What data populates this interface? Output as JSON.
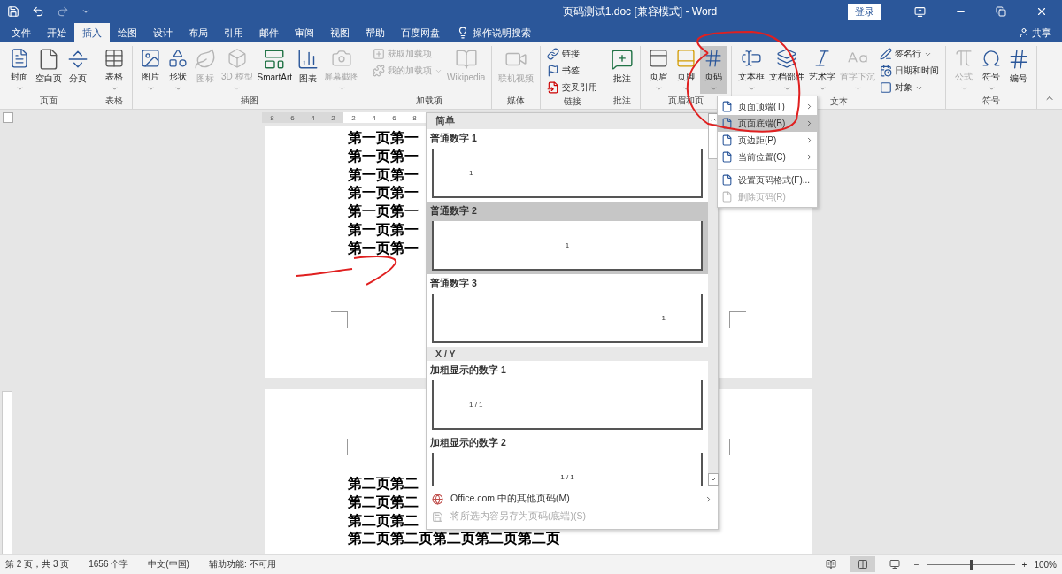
{
  "window": {
    "title": "页码测试1.doc [兼容模式] - Word",
    "login": "登录"
  },
  "tabs": [
    {
      "label": "文件",
      "selected": false
    },
    {
      "label": "开始",
      "selected": false
    },
    {
      "label": "插入",
      "selected": true
    },
    {
      "label": "绘图",
      "selected": false
    },
    {
      "label": "设计",
      "selected": false
    },
    {
      "label": "布局",
      "selected": false
    },
    {
      "label": "引用",
      "selected": false
    },
    {
      "label": "邮件",
      "selected": false
    },
    {
      "label": "审阅",
      "selected": false
    },
    {
      "label": "视图",
      "selected": false
    },
    {
      "label": "帮助",
      "selected": false
    },
    {
      "label": "百度网盘",
      "selected": false
    }
  ],
  "tell_me": "操作说明搜索",
  "share": "共享",
  "ribbon": {
    "groups": [
      {
        "label": "页面",
        "buttons": [
          {
            "label": "封面",
            "kind": "large",
            "dropdown": true,
            "disabled": false,
            "selected": false
          },
          {
            "label": "空白页",
            "kind": "large",
            "dropdown": false,
            "disabled": false,
            "selected": false
          },
          {
            "label": "分页",
            "kind": "large",
            "dropdown": false,
            "disabled": false,
            "selected": false
          }
        ]
      },
      {
        "label": "表格",
        "buttons": [
          {
            "label": "表格",
            "kind": "large",
            "dropdown": true,
            "disabled": false,
            "selected": false
          }
        ]
      },
      {
        "label": "插图",
        "buttons": [
          {
            "label": "图片",
            "kind": "large",
            "dropdown": true,
            "disabled": false,
            "selected": false
          },
          {
            "label": "形状",
            "kind": "large",
            "dropdown": true,
            "disabled": false,
            "selected": false
          },
          {
            "label": "图标",
            "kind": "large",
            "dropdown": false,
            "disabled": true,
            "selected": false
          },
          {
            "label": "3D 模型",
            "kind": "large",
            "dropdown": true,
            "disabled": true,
            "selected": false
          },
          {
            "label": "SmartArt",
            "kind": "large",
            "dropdown": false,
            "disabled": false,
            "selected": false
          },
          {
            "label": "图表",
            "kind": "large",
            "dropdown": false,
            "disabled": false,
            "selected": false
          },
          {
            "label": "屏幕截图",
            "kind": "large",
            "dropdown": true,
            "disabled": true,
            "selected": false
          }
        ]
      },
      {
        "label": "加载项",
        "buttons": [
          {
            "label": "获取加载项",
            "kind": "small",
            "dropdown": false,
            "disabled": true,
            "selected": false
          },
          {
            "label": "我的加载项",
            "kind": "small",
            "dropdown": true,
            "disabled": true,
            "selected": false
          },
          {
            "label": "Wikipedia",
            "kind": "large",
            "dropdown": false,
            "disabled": true,
            "selected": false
          }
        ]
      },
      {
        "label": "媒体",
        "buttons": [
          {
            "label": "联机视频",
            "kind": "large",
            "dropdown": false,
            "disabled": true,
            "selected": false
          }
        ]
      },
      {
        "label": "链接",
        "buttons": [
          {
            "label": "链接",
            "kind": "small",
            "dropdown": false,
            "disabled": false,
            "selected": false
          },
          {
            "label": "书签",
            "kind": "small",
            "dropdown": false,
            "disabled": false,
            "selected": false
          },
          {
            "label": "交叉引用",
            "kind": "small",
            "dropdown": false,
            "disabled": false,
            "selected": false
          }
        ]
      },
      {
        "label": "批注",
        "buttons": [
          {
            "label": "批注",
            "kind": "large",
            "dropdown": false,
            "disabled": false,
            "selected": false
          }
        ]
      },
      {
        "label": "页眉和页",
        "buttons": [
          {
            "label": "页眉",
            "kind": "large",
            "dropdown": true,
            "disabled": false,
            "selected": false
          },
          {
            "label": "页脚",
            "kind": "large",
            "dropdown": true,
            "disabled": false,
            "selected": false
          },
          {
            "label": "页码",
            "kind": "large",
            "dropdown": true,
            "disabled": false,
            "selected": true
          }
        ]
      },
      {
        "label": "文本",
        "buttons": [
          {
            "label": "文本框",
            "kind": "large",
            "dropdown": true,
            "disabled": false,
            "selected": false
          },
          {
            "label": "文档部件",
            "kind": "large",
            "dropdown": true,
            "disabled": false,
            "selected": false
          },
          {
            "label": "艺术字",
            "kind": "large",
            "dropdown": true,
            "disabled": false,
            "selected": false
          },
          {
            "label": "首字下沉",
            "kind": "large",
            "dropdown": true,
            "disabled": true,
            "selected": false
          },
          {
            "label": "签名行",
            "kind": "small",
            "dropdown": true,
            "disabled": false,
            "selected": false
          },
          {
            "label": "日期和时间",
            "kind": "small",
            "dropdown": false,
            "disabled": false,
            "selected": false
          },
          {
            "label": "对象",
            "kind": "small",
            "dropdown": true,
            "disabled": false,
            "selected": false
          }
        ]
      },
      {
        "label": "符号",
        "buttons": [
          {
            "label": "公式",
            "kind": "large",
            "dropdown": true,
            "disabled": true,
            "selected": false
          },
          {
            "label": "符号",
            "kind": "large",
            "dropdown": true,
            "disabled": false,
            "selected": false
          },
          {
            "label": "编号",
            "kind": "large",
            "dropdown": false,
            "disabled": false,
            "selected": false
          }
        ]
      }
    ]
  },
  "ruler": {
    "left_numbers": [
      "8",
      "6",
      "4",
      "2"
    ],
    "right_numbers": [
      "2",
      "4",
      "6",
      "8"
    ]
  },
  "pages": [
    {
      "lines": [
        "第一页第一",
        "第一页第一",
        "第一页第一",
        "第一页第一",
        "第一页第一",
        "第一页第一",
        "第一页第一"
      ]
    },
    {
      "lines": [
        "第二页第二",
        "第二页第二",
        "第二页第二",
        "第二页第二页第二页第二页第二页"
      ]
    }
  ],
  "page_number_gallery": {
    "sections": [
      {
        "heading": "简单",
        "items": [
          {
            "label": "普通数字 1",
            "preview": "1",
            "selected": false
          },
          {
            "label": "普通数字 2",
            "preview": "1",
            "selected": true
          },
          {
            "label": "普通数字 3",
            "preview": "1",
            "selected": false
          }
        ]
      },
      {
        "heading": "X / Y",
        "items": [
          {
            "label": "加粗显示的数字 1",
            "preview": "1 / 1",
            "selected": false
          },
          {
            "label": "加粗显示的数字 2",
            "preview": "1 / 1",
            "selected": false
          }
        ]
      }
    ],
    "footer": [
      {
        "label": "Office.com 中的其他页码(M)",
        "submenu": true,
        "disabled": false
      },
      {
        "label": "将所选内容另存为页码(底端)(S)",
        "submenu": false,
        "disabled": true
      }
    ]
  },
  "submenu": {
    "items": [
      {
        "label": "页面顶端(T)",
        "submenu": true,
        "selected": false,
        "disabled": false,
        "separator_before": false
      },
      {
        "label": "页面底端(B)",
        "submenu": true,
        "selected": true,
        "disabled": false,
        "separator_before": false
      },
      {
        "label": "页边距(P)",
        "submenu": true,
        "selected": false,
        "disabled": false,
        "separator_before": false
      },
      {
        "label": "当前位置(C)",
        "submenu": true,
        "selected": false,
        "disabled": false,
        "separator_before": false
      },
      {
        "label": "设置页码格式(F)...",
        "submenu": false,
        "selected": false,
        "disabled": false,
        "separator_before": true
      },
      {
        "label": "删除页码(R)",
        "submenu": false,
        "selected": false,
        "disabled": true,
        "separator_before": false
      }
    ]
  },
  "status_bar": {
    "items": [
      "第 2 页，共 3 页",
      "1656 个字",
      "中文(中国)",
      "辅助功能: 不可用"
    ],
    "views": [
      {
        "selected": false
      },
      {
        "selected": true
      },
      {
        "selected": false
      }
    ],
    "zoom": {
      "minus": "−",
      "plus": "+",
      "level": 0.5,
      "reading": "100%"
    }
  }
}
